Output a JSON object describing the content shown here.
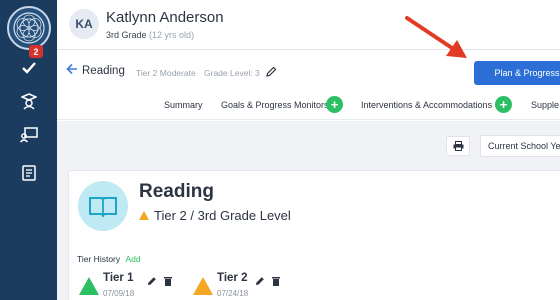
{
  "sidebar": {
    "badge_count": "2",
    "items": [
      "check-icon",
      "graduation-icon",
      "teacher-board-icon",
      "book-icon"
    ]
  },
  "header": {
    "avatar_initials": "KA",
    "student_name": "Katlynn Anderson",
    "grade": "3rd Grade",
    "age": "(12 yrs old)"
  },
  "subheader": {
    "subject": "Reading",
    "tier": "Tier 2 Moderate",
    "grade_level": "Grade Level: 3",
    "plan_button": "Plan & Progress"
  },
  "tabs": [
    {
      "label": "Summary"
    },
    {
      "label": "Goals & Progress Monitors"
    },
    {
      "label": "Interventions & Accommodations"
    },
    {
      "label": "Supple"
    }
  ],
  "filters": {
    "school_year": "Current School Year"
  },
  "card": {
    "title": "Reading",
    "tier_line": "Tier 2 / 3rd Grade Level",
    "history_label": "Tier History",
    "history_add": "Add",
    "tiers": [
      {
        "name": "Tier 1",
        "date": "07/09/18",
        "color": "#2cbf63"
      },
      {
        "name": "Tier 2",
        "date": "07/24/18",
        "color": "#f5a623"
      }
    ]
  },
  "colors": {
    "sidebar": "#1b3b5f",
    "primary": "#2b6fd6",
    "success": "#2cbf63",
    "warning": "#f5a623",
    "annotation": "#e23b25"
  }
}
